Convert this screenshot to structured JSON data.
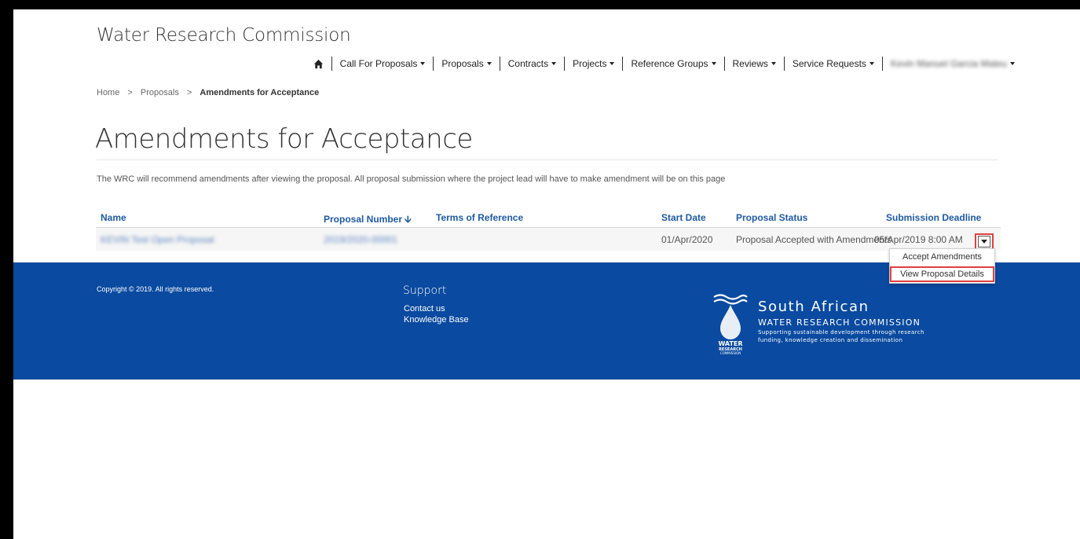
{
  "app": {
    "brand": "Water Research Commission"
  },
  "nav": {
    "items": [
      {
        "label": "Call For Proposals"
      },
      {
        "label": "Proposals"
      },
      {
        "label": "Contracts"
      },
      {
        "label": "Projects"
      },
      {
        "label": "Reference Groups"
      },
      {
        "label": "Reviews"
      },
      {
        "label": "Service Requests"
      }
    ],
    "user_name": "Kevin Manuel Garcia Mateu"
  },
  "breadcrumb": {
    "home": "Home",
    "sep": ">",
    "proposals": "Proposals",
    "current": "Amendments for Acceptance"
  },
  "page": {
    "title": "Amendments for Acceptance",
    "intro": "The WRC will recommend amendments after viewing the proposal.  All proposal submission where the project lead will have to make amendment will be on this page"
  },
  "table": {
    "columns": [
      "Name",
      "Proposal Number",
      "Terms of Reference",
      "Start Date",
      "Proposal Status",
      "Submission Deadline"
    ],
    "rows": [
      {
        "name": "KEVIN Test Open Proposal",
        "proposal_number": "2019/2020-00001",
        "terms_of_reference": "",
        "start_date": "01/Apr/2020",
        "status": "Proposal Accepted with Amendments",
        "deadline": "05/Apr/2019 8:00 AM"
      }
    ]
  },
  "row_menu": {
    "items": [
      "Accept Amendments",
      "View Proposal Details"
    ]
  },
  "footer": {
    "copyright": "Copyright © 2019. All rights reserved.",
    "support_title": "Support",
    "support_links": [
      "Contact us",
      "Knowledge Base"
    ],
    "logo": {
      "title": "South African",
      "subtitle": "WATER RESEARCH COMMISSION",
      "tagline1": "Supporting sustainable development through research",
      "tagline2": "funding, knowledge creation and dissemination",
      "mark_text_1": "WATER",
      "mark_text_2": "RESEARCH",
      "mark_text_3": "COMMISSION"
    }
  },
  "colors": {
    "footer_bg": "#0a4aa0",
    "header_text": "#1e5aa0",
    "highlight": "#e04040"
  }
}
